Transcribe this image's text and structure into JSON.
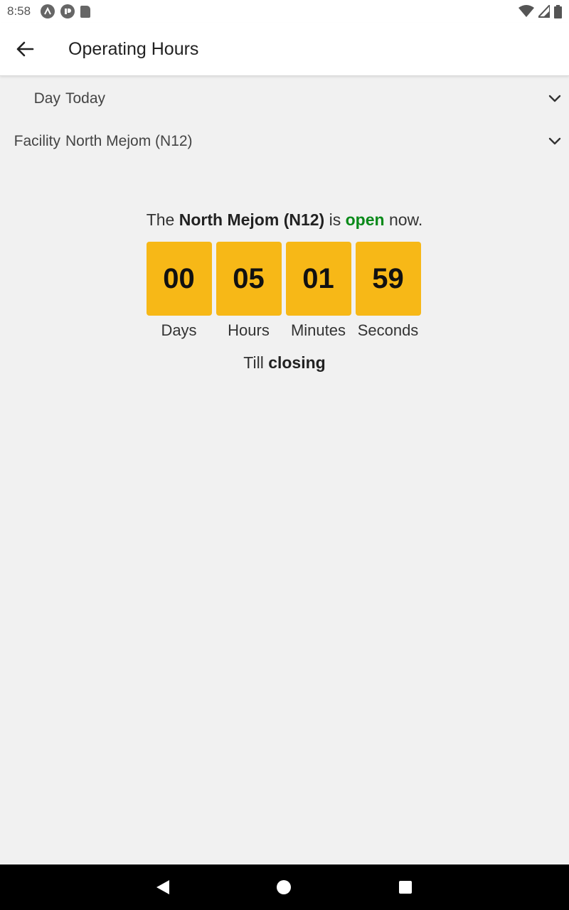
{
  "status_bar": {
    "time": "8:58",
    "left_icons": [
      "android-auto-icon",
      "parking-app-icon",
      "sd-card-icon"
    ],
    "right_icons": [
      "wifi-icon",
      "cell-signal-icon",
      "battery-icon"
    ]
  },
  "app_bar": {
    "title": "Operating Hours",
    "back_icon": "arrow-back-icon"
  },
  "filters": {
    "day": {
      "label": "Day",
      "value": "Today"
    },
    "facility": {
      "label": "Facility",
      "value": "North Mejom (N12)"
    }
  },
  "status": {
    "prefix": "The",
    "facility": "North Mejom (N12)",
    "middle": "is",
    "state": "open",
    "suffix": "now.",
    "state_color": "#0a8a1a"
  },
  "countdown": {
    "box_color": "#f7b817",
    "units": [
      {
        "value": "00",
        "label": "Days"
      },
      {
        "value": "05",
        "label": "Hours"
      },
      {
        "value": "01",
        "label": "Minutes"
      },
      {
        "value": "59",
        "label": "Seconds"
      }
    ]
  },
  "till": {
    "prefix": "Till",
    "event": "closing"
  },
  "nav_bar": {
    "buttons": [
      "back-triangle-icon",
      "home-circle-icon",
      "recents-square-icon"
    ]
  }
}
